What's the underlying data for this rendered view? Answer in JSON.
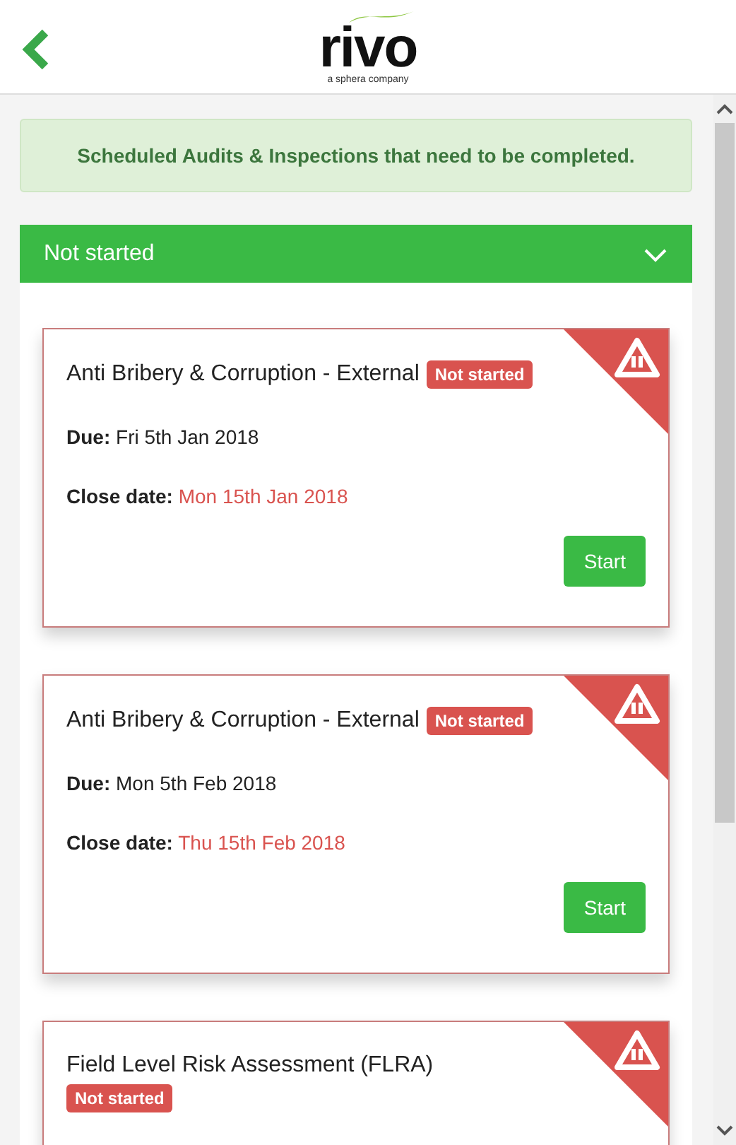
{
  "header": {
    "logo": "rivo",
    "tagline": "a sphera company"
  },
  "notice": "Scheduled Audits & Inspections that need to be completed.",
  "section": {
    "title": "Not started",
    "expanded": true
  },
  "cards": [
    {
      "title": "Anti Bribery & Corruption - External",
      "status": "Not started",
      "badge_below": false,
      "due_label": "Due:",
      "due": "Fri 5th Jan 2018",
      "close_label": "Close date:",
      "close": "Mon 15th Jan 2018",
      "button": "Start"
    },
    {
      "title": "Anti Bribery & Corruption - External",
      "status": "Not started",
      "badge_below": false,
      "due_label": "Due:",
      "due": "Mon 5th Feb 2018",
      "close_label": "Close date:",
      "close": "Thu 15th Feb 2018",
      "button": "Start"
    },
    {
      "title": "Field Level Risk Assessment (FLRA)",
      "status": "Not started",
      "badge_below": true
    }
  ]
}
